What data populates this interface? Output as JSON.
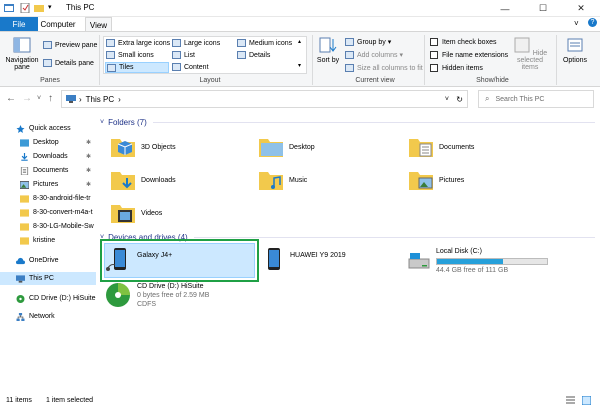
{
  "window": {
    "title": "This PC",
    "controls": {
      "minimize": "—",
      "maximize": "☐",
      "close": "✕"
    }
  },
  "ribbon_tabs": [
    "File",
    "Computer",
    "View"
  ],
  "ribbon": {
    "navigation_pane": "Navigation pane",
    "preview_pane": "Preview pane",
    "details_pane": "Details pane",
    "panes_label": "Panes",
    "layout_items": [
      "Extra large icons",
      "Large icons",
      "Medium icons",
      "Small icons",
      "List",
      "Details",
      "Tiles",
      "Content"
    ],
    "layout_label": "Layout",
    "sort_by": "Sort by",
    "group_by": "Group by",
    "add_columns": "Add columns",
    "size_all_columns": "Size all columns to fit",
    "current_view_label": "Current view",
    "item_check_boxes": "Item check boxes",
    "file_name_extensions": "File name extensions",
    "hidden_items": "Hidden items",
    "hide_selected": "Hide selected items",
    "show_hide_label": "Show/hide",
    "options": "Options"
  },
  "address": {
    "path": "This PC",
    "search_placeholder": "Search This PC"
  },
  "nav_pane": {
    "items": [
      {
        "label": "Quick access",
        "icon": "star-icon",
        "pinned": false
      },
      {
        "label": "Desktop",
        "icon": "desktop-icon",
        "pinned": true
      },
      {
        "label": "Downloads",
        "icon": "downloads-icon",
        "pinned": true
      },
      {
        "label": "Documents",
        "icon": "documents-icon",
        "pinned": true
      },
      {
        "label": "Pictures",
        "icon": "pictures-icon",
        "pinned": true
      },
      {
        "label": "8-30-android-file-tr",
        "icon": "folder-icon",
        "pinned": false
      },
      {
        "label": "8-30-convert-m4a-t",
        "icon": "folder-icon",
        "pinned": false
      },
      {
        "label": "8-30-LG-Mobile-Sw",
        "icon": "folder-icon",
        "pinned": false
      },
      {
        "label": "kristine",
        "icon": "folder-icon",
        "pinned": false
      },
      {
        "label": "OneDrive",
        "icon": "cloud-icon",
        "pinned": false
      },
      {
        "label": "This PC",
        "icon": "computer-icon",
        "pinned": false
      },
      {
        "label": "CD Drive (D:) HiSuite",
        "icon": "cd-drive-icon",
        "pinned": false
      },
      {
        "label": "Network",
        "icon": "network-icon",
        "pinned": false
      }
    ]
  },
  "folders": {
    "header": "Folders (7)",
    "items": [
      {
        "label": "3D Objects",
        "icon": "3d-objects-folder-icon"
      },
      {
        "label": "Desktop",
        "icon": "desktop-folder-icon"
      },
      {
        "label": "Documents",
        "icon": "documents-folder-icon"
      },
      {
        "label": "Downloads",
        "icon": "downloads-folder-icon"
      },
      {
        "label": "Music",
        "icon": "music-folder-icon"
      },
      {
        "label": "Pictures",
        "icon": "pictures-folder-icon"
      },
      {
        "label": "Videos",
        "icon": "videos-folder-icon"
      }
    ]
  },
  "drives": {
    "header": "Devices and drives (4)",
    "items": [
      {
        "label": "Galaxy J4+",
        "icon": "phone-device-icon",
        "selected": true
      },
      {
        "label": "HUAWEI Y9 2019",
        "icon": "phone-device-icon",
        "selected": false
      },
      {
        "label": "Local Disk (C:)",
        "icon": "hard-disk-icon",
        "free": "44.4 GB free of 111 GB",
        "used_fraction": 0.6
      },
      {
        "label": "CD Drive (D:) HiSuite",
        "icon": "cd-drive-icon",
        "free": "0 bytes free of 2.59 MB",
        "fs": "CDFS"
      }
    ]
  },
  "status": {
    "items": "11 items",
    "selected": "1 item selected"
  },
  "colors": {
    "accent": "#1979ca",
    "selection": "#cce8ff",
    "highlight_box": "#1fa045",
    "group_header": "#1e3287",
    "folder": "#f2c94c",
    "disk_bar": "#26a0da"
  }
}
